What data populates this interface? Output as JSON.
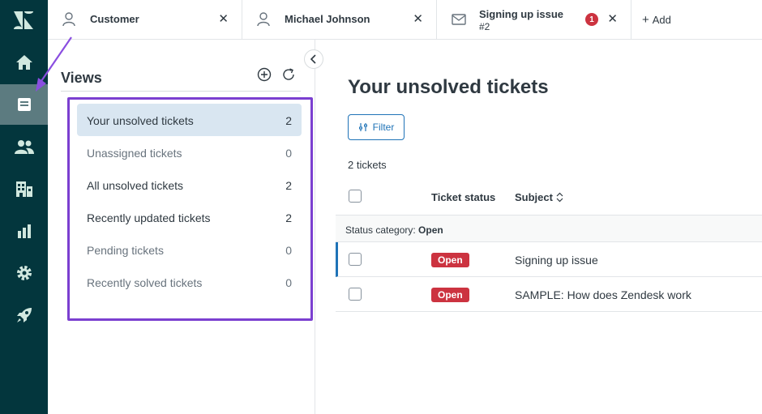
{
  "rail": {
    "items": [
      {
        "icon": "zendesk-logo-icon"
      },
      {
        "icon": "home-icon"
      },
      {
        "icon": "views-icon",
        "active": true
      },
      {
        "icon": "customers-icon"
      },
      {
        "icon": "organizations-icon"
      },
      {
        "icon": "reporting-icon"
      },
      {
        "icon": "admin-gear-icon"
      },
      {
        "icon": "rocket-icon"
      }
    ]
  },
  "tabs": [
    {
      "label": "Customer",
      "icon": "user-icon"
    },
    {
      "label": "Michael Johnson",
      "icon": "user-icon"
    },
    {
      "label": "Signing up issue",
      "sub": "#2",
      "icon": "mail-icon",
      "badge": "1"
    }
  ],
  "add_tab_label": "Add",
  "views": {
    "title": "Views",
    "items": [
      {
        "label": "Your unsolved tickets",
        "count": "2"
      },
      {
        "label": "Unassigned tickets",
        "count": "0"
      },
      {
        "label": "All unsolved tickets",
        "count": "2"
      },
      {
        "label": "Recently updated tickets",
        "count": "2"
      },
      {
        "label": "Pending tickets",
        "count": "0"
      },
      {
        "label": "Recently solved tickets",
        "count": "0"
      }
    ]
  },
  "main": {
    "title": "Your unsolved tickets",
    "filter_label": "Filter",
    "ticket_count": "2 tickets",
    "columns": {
      "status": "Ticket status",
      "subject": "Subject"
    },
    "group_prefix": "Status category: ",
    "group_value": "Open",
    "rows": [
      {
        "status": "Open",
        "subject": "Signing up issue"
      },
      {
        "status": "Open",
        "subject": "SAMPLE: How does Zendesk work"
      }
    ]
  },
  "colors": {
    "rail_bg": "#03363d",
    "accent": "#1f73b7",
    "status_open": "#cc3340",
    "highlight": "#7b3fd0"
  }
}
